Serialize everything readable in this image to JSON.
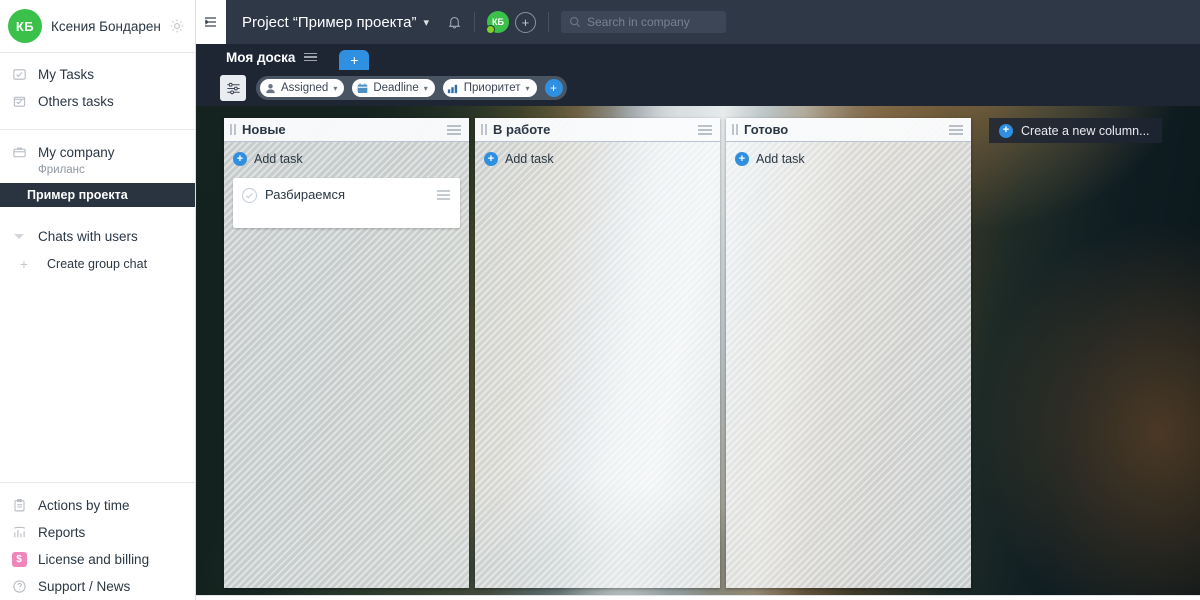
{
  "sidebar": {
    "user": {
      "initials": "КБ",
      "name": "Ксения Бондаренко",
      "settings_icon": "gear-icon"
    },
    "items": [
      {
        "label": "My Tasks",
        "icon": "tasks-icon"
      },
      {
        "label": "Others tasks",
        "icon": "others-tasks-icon"
      }
    ],
    "company": {
      "label": "My company",
      "subtitle": "Фриланс",
      "icon": "briefcase-icon"
    },
    "selected_project": "Пример проекта",
    "chats": {
      "label": "Chats with users",
      "create": "Create group chat"
    },
    "bottom_items": [
      {
        "label": "Actions by time",
        "icon": "clipboard-icon"
      },
      {
        "label": "Reports",
        "icon": "reports-chart-icon"
      },
      {
        "label": "License and billing",
        "icon": "billing-icon"
      },
      {
        "label": "Support / News",
        "icon": "help-icon"
      }
    ]
  },
  "header": {
    "collapse_icon": "collapse-sidebar-icon",
    "project_title": "Project “Пример проекта”",
    "chevron": "▾",
    "bell_icon": "notification-bell-icon",
    "mini_avatar_initials": "КБ",
    "add_user_label": "+",
    "search_placeholder": "Search in company",
    "search_icon": "search-icon"
  },
  "tabs": {
    "items": [
      {
        "label": "Моя доска",
        "menu_icon": "tab-menu-icon"
      }
    ],
    "add_label": "+"
  },
  "toolbar": {
    "filter_settings_icon": "filter-settings-icon",
    "chips": [
      {
        "label": "Assigned",
        "icon": "person-icon",
        "caret": "▾"
      },
      {
        "label": "Deadline",
        "icon": "calendar-icon",
        "caret": "▾"
      },
      {
        "label": "Приоритет",
        "icon": "priority-bars-icon",
        "caret": "▾"
      }
    ],
    "add_filter_label": "+"
  },
  "board": {
    "add_task_label": "Add task",
    "create_column_label": "Create a new column...",
    "columns": [
      {
        "title": "Новые",
        "cards": [
          {
            "title": "Разбираемся"
          }
        ]
      },
      {
        "title": "В работе",
        "cards": []
      },
      {
        "title": "Готово",
        "cards": []
      }
    ]
  },
  "colors": {
    "accent_blue": "#2f8fe0",
    "avatar_green": "#3bc14a",
    "header_dark": "#2e3847",
    "strip_dark": "#1e2634",
    "selected_row": "#2a3441",
    "billing_pink": "#e4177c"
  }
}
